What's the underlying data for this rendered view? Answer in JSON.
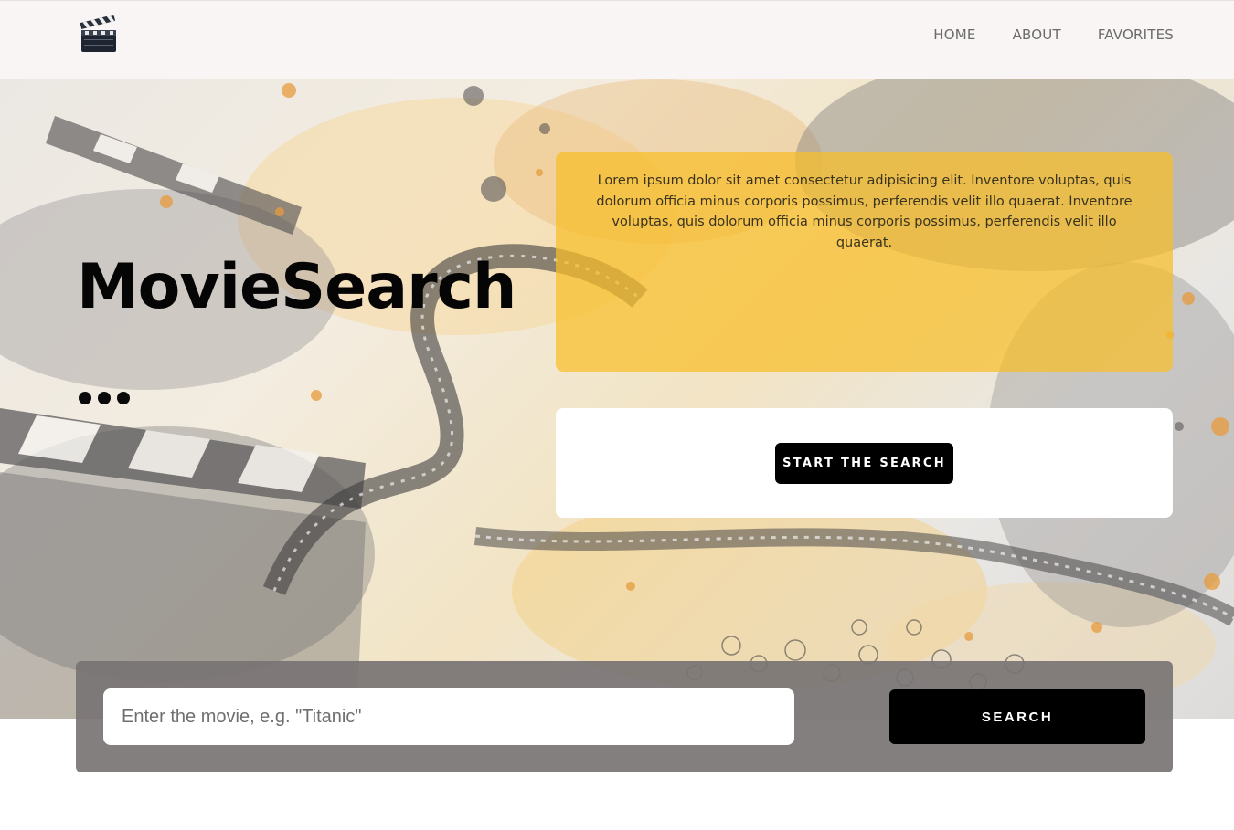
{
  "header": {
    "logo_icon": "clapperboard-icon",
    "nav": [
      {
        "label": "HOME"
      },
      {
        "label": "ABOUT"
      },
      {
        "label": "FAVORITES"
      }
    ]
  },
  "hero": {
    "title": "MovieSearch",
    "description": "Lorem ipsum dolor sit amet consectetur adipisicing elit. Inventore voluptas, quis dolorum officia minus corporis possimus, perferendis velit illo quaerat. Inventore voluptas, quis dolorum officia minus corporis possimus, perferendis velit illo quaerat.",
    "cta_label": "START THE SEARCH"
  },
  "search": {
    "placeholder": "Enter the movie, e.g. \"Titanic\"",
    "value": "",
    "button_label": "SEARCH"
  },
  "colors": {
    "accent_yellow": "#f8be28",
    "button_black": "#000000",
    "header_bg": "#f9f5f4",
    "panel_gray": "#787474"
  }
}
